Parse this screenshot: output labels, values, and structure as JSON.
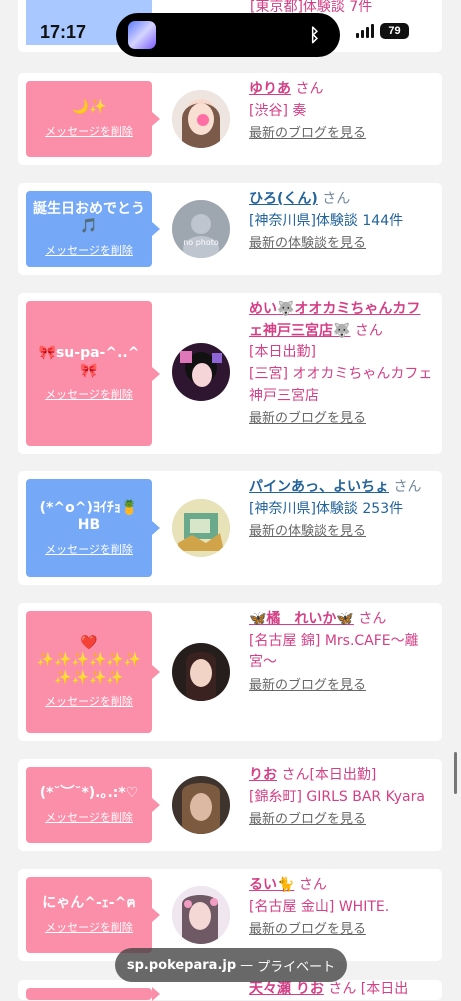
{
  "status_bar": {
    "time": "17:17",
    "battery": "79"
  },
  "top_partial": {
    "text": "[東京都]体験談 7件"
  },
  "items": [
    {
      "bubble_color": "#fb8ea8",
      "message": "🌙✨",
      "delete_label": "メッセージを削除",
      "name": "ゆりあ",
      "suffix": "さん",
      "line1": "[渋谷] 奏",
      "line2": "",
      "link": "最新のブログを見る",
      "avatar_type": "photo"
    },
    {
      "bubble_color": "#75a8f6",
      "message": "誕生日おめでとう\n🎵",
      "delete_label": "メッセージを削除",
      "name": "ひろ(くん)",
      "suffix": "さん",
      "line1": "[神奈川県]体験談 144件",
      "line2": "",
      "link": "最新の体験談を見る",
      "avatar_type": "nophoto",
      "avatar_label": "no photo"
    },
    {
      "bubble_color": "#fb8ea8",
      "message": "🎀su-pa-^..^🎀",
      "delete_label": "メッセージを削除",
      "name": "めい🐺オオカミちゃんカフェ神戸三宮店🐺",
      "suffix": "さん",
      "line1": "[本日出勤]",
      "line2": "[三宮] オオカミちゃんカフェ神戸三宮店",
      "link": "最新のブログを見る",
      "avatar_type": "photo"
    },
    {
      "bubble_color": "#75a8f6",
      "message": "(*^o^)ﾖｲﾁｮ🍍HB",
      "delete_label": "メッセージを削除",
      "name": "パインあっ、よいちょ",
      "suffix": "さん",
      "line1": "[神奈川県]体験談 253件",
      "line2": "",
      "link": "最新の体験談を見る",
      "avatar_type": "photo"
    },
    {
      "bubble_color": "#fb8ea8",
      "message": "❤️\n✨✨✨✨✨✨\n✨✨✨✨",
      "delete_label": "メッセージを削除",
      "name": "🦋橘　れいか🦋",
      "suffix": "さん",
      "line1": "[名古屋 錦] Mrs.CAFE〜離宮〜",
      "line2": "",
      "link": "最新のブログを見る",
      "avatar_type": "photo"
    },
    {
      "bubble_color": "#fb8ea8",
      "message": "(*˘︶˘*).｡.:*♡",
      "delete_label": "メッセージを削除",
      "name": "りお",
      "suffix": "さん[本日出勤]",
      "line1": "[錦糸町] GIRLS BAR Kyara",
      "line2": "",
      "link": "最新のブログを見る",
      "avatar_type": "photo"
    },
    {
      "bubble_color": "#fb8ea8",
      "message": "にゃん^-ｪ-^ฅ",
      "delete_label": "メッセージを削除",
      "name": "るい🐈",
      "suffix": "さん",
      "line1": "[名古屋 金山] WHITE.",
      "line2": "",
      "link": "最新のブログを見る",
      "avatar_type": "photo"
    }
  ],
  "bottom_partial": {
    "name": "天々瀬 りお",
    "suffix": "さん",
    "tail": "[本日出"
  },
  "url_bar": {
    "domain": "sp.pokepara.jp",
    "separator": "—",
    "mode": "プライベート"
  }
}
